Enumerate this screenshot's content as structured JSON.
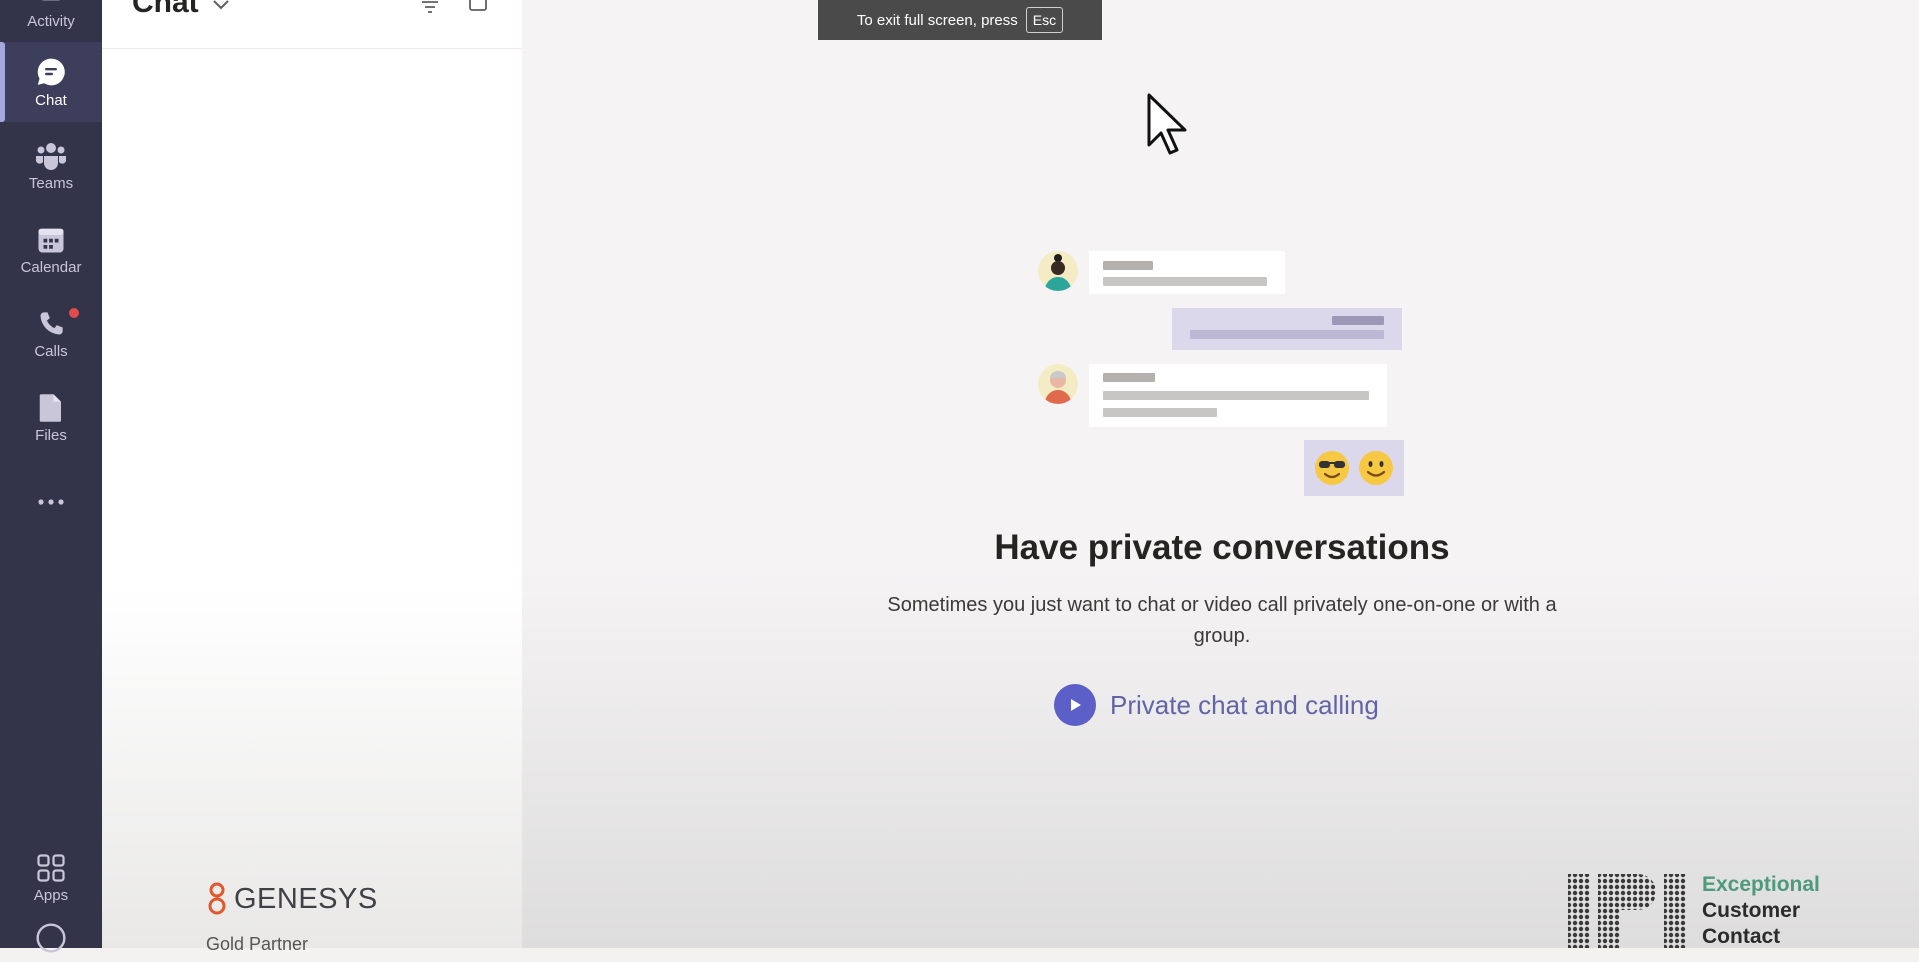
{
  "rail": {
    "items": [
      {
        "label": "Activity",
        "icon": "bell-icon"
      },
      {
        "label": "Chat",
        "icon": "chat-bubble-icon",
        "active": true
      },
      {
        "label": "Teams",
        "icon": "teams-icon"
      },
      {
        "label": "Calendar",
        "icon": "calendar-icon"
      },
      {
        "label": "Calls",
        "icon": "phone-icon",
        "badge": true
      },
      {
        "label": "Files",
        "icon": "file-icon"
      },
      {
        "label": "",
        "icon": "more-icon"
      },
      {
        "label": "Apps",
        "icon": "apps-grid-icon"
      },
      {
        "label": "",
        "icon": "help-icon"
      }
    ]
  },
  "chat_list": {
    "title": "Chat"
  },
  "fullscreen_banner": {
    "text": "To exit full screen, press",
    "key": "Esc"
  },
  "empty_state": {
    "headline": "Have private conversations",
    "description": "Sometimes you just want to chat or video call privately one-on-one or with a group.",
    "video_link": "Private chat and calling",
    "emojis": [
      "😎",
      "🙂"
    ]
  },
  "watermarks": {
    "genesys_logo": "GENESYS",
    "genesys_sub": "Gold Partner",
    "ipi_lines": [
      "Exceptional",
      "Customer",
      "Contact"
    ]
  },
  "colors": {
    "rail_bg": "#33344a",
    "accent": "#6264a7",
    "play_button": "#5b5fc7",
    "badge": "#e04b4b",
    "ipi_green": "#4d9a7c",
    "genesys_orange": "#e2572b"
  }
}
